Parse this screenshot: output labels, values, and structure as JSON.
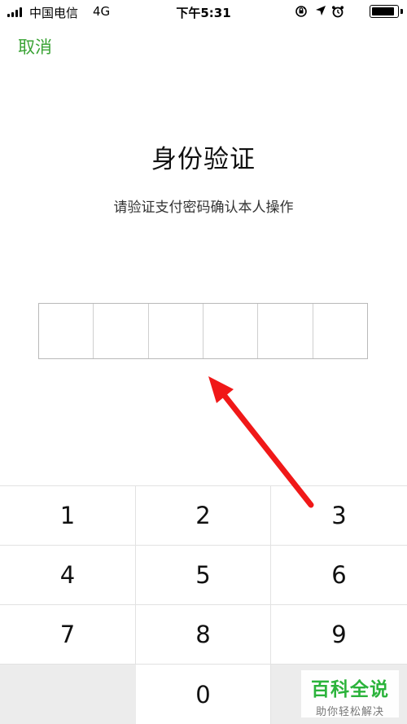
{
  "status_bar": {
    "carrier": "中国电信",
    "network": "4G",
    "time": "下午5:31",
    "signal_bars": 4,
    "battery_level": 0.9,
    "icons": [
      "rotation-lock-icon",
      "location-arrow-icon",
      "alarm-icon"
    ]
  },
  "header": {
    "cancel_label": "取消"
  },
  "main": {
    "title": "身份验证",
    "subtitle": "请验证支付密码确认本人操作",
    "pin_length": 6
  },
  "keypad": {
    "keys": [
      "1",
      "2",
      "3",
      "4",
      "5",
      "6",
      "7",
      "8",
      "9",
      "",
      "0",
      ""
    ]
  },
  "watermark": {
    "main": "百科全说",
    "sub": "助你轻松解决"
  },
  "colors": {
    "accent_green": "#3aa335",
    "arrow_red": "#f01818",
    "keypad_blank": "#ececec"
  }
}
